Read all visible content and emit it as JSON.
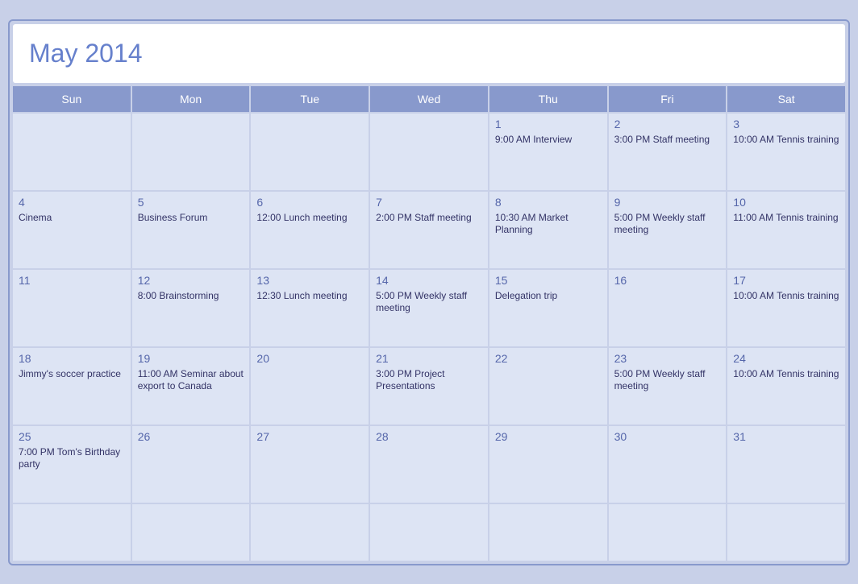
{
  "title": "May 2014",
  "headers": [
    "Sun",
    "Mon",
    "Tue",
    "Wed",
    "Thu",
    "Fri",
    "Sat"
  ],
  "weeks": [
    [
      {
        "number": "",
        "event": ""
      },
      {
        "number": "",
        "event": ""
      },
      {
        "number": "",
        "event": ""
      },
      {
        "number": "",
        "event": ""
      },
      {
        "number": "1",
        "event": "9:00 AM Interview"
      },
      {
        "number": "2",
        "event": "3:00 PM Staff meeting"
      },
      {
        "number": "3",
        "event": "10:00 AM Tennis training"
      }
    ],
    [
      {
        "number": "4",
        "event": "Cinema"
      },
      {
        "number": "5",
        "event": "Business Forum"
      },
      {
        "number": "6",
        "event": "12:00 Lunch meeting"
      },
      {
        "number": "7",
        "event": "2:00 PM Staff meeting"
      },
      {
        "number": "8",
        "event": "10:30 AM Market Planning"
      },
      {
        "number": "9",
        "event": "5:00 PM Weekly staff meeting"
      },
      {
        "number": "10",
        "event": "11:00 AM Tennis training"
      }
    ],
    [
      {
        "number": "11",
        "event": ""
      },
      {
        "number": "12",
        "event": "8:00 Brainstorming"
      },
      {
        "number": "13",
        "event": "12:30 Lunch meeting"
      },
      {
        "number": "14",
        "event": "5:00 PM Weekly staff meeting"
      },
      {
        "number": "15",
        "event": "Delegation trip"
      },
      {
        "number": "16",
        "event": ""
      },
      {
        "number": "17",
        "event": "10:00 AM Tennis training"
      }
    ],
    [
      {
        "number": "18",
        "event": "Jimmy's soccer practice"
      },
      {
        "number": "19",
        "event": "11:00 AM Seminar about export to Canada"
      },
      {
        "number": "20",
        "event": ""
      },
      {
        "number": "21",
        "event": "3:00 PM Project Presentations"
      },
      {
        "number": "22",
        "event": ""
      },
      {
        "number": "23",
        "event": "5:00 PM Weekly staff meeting"
      },
      {
        "number": "24",
        "event": "10:00 AM Tennis training"
      }
    ],
    [
      {
        "number": "25",
        "event": "7:00 PM Tom's Birthday party"
      },
      {
        "number": "26",
        "event": ""
      },
      {
        "number": "27",
        "event": ""
      },
      {
        "number": "28",
        "event": ""
      },
      {
        "number": "29",
        "event": ""
      },
      {
        "number": "30",
        "event": ""
      },
      {
        "number": "31",
        "event": ""
      }
    ],
    [
      {
        "number": "",
        "event": ""
      },
      {
        "number": "",
        "event": ""
      },
      {
        "number": "",
        "event": ""
      },
      {
        "number": "",
        "event": ""
      },
      {
        "number": "",
        "event": ""
      },
      {
        "number": "",
        "event": ""
      },
      {
        "number": "",
        "event": ""
      }
    ]
  ]
}
